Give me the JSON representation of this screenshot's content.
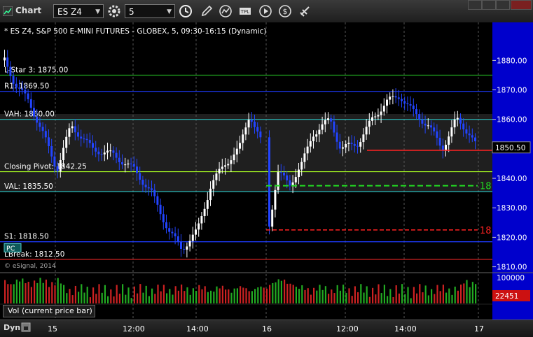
{
  "window": {
    "title": "Chart"
  },
  "toolbar": {
    "symbol": "ES Z4",
    "interval": "5"
  },
  "chart": {
    "header": "* ES Z4, S&P 500 E-MINI FUTURES - GLOBEX, 5, 09:30-16:15 (Dynamic)",
    "copyright": "© eSignal, 2014",
    "price_axis": [
      "1880.00",
      "1870.00",
      "1860.00",
      "1850.00",
      "1840.00",
      "1830.00",
      "1820.00",
      "1810.00"
    ],
    "current_price": "1850.50",
    "ylim": [
      1808,
      1891
    ],
    "levels": [
      {
        "label": "L-Star 3: 1875.00",
        "price": 1875.0,
        "color": "#22aa22"
      },
      {
        "label": "R1: 1869.50",
        "price": 1869.5,
        "color": "#1e3cff"
      },
      {
        "label": "VAH: 1860.00",
        "price": 1860.0,
        "color": "#2bbaba"
      },
      {
        "label": "Closing Pivot: 1842.25",
        "price": 1842.25,
        "color": "#aaff22"
      },
      {
        "label": "VAL: 1835.50",
        "price": 1835.5,
        "color": "#2bbaba"
      },
      {
        "label": "S1: 1818.50",
        "price": 1818.5,
        "color": "#1e3cff"
      },
      {
        "label": "LBreak: 1812.50",
        "price": 1812.5,
        "color": "#cc2222"
      }
    ],
    "trend_labels": {
      "green": "18",
      "red": "18"
    },
    "pc_badge": "PC",
    "time_axis": [
      "15",
      "12:00",
      "14:00",
      "16",
      "12:00",
      "14:00",
      "17"
    ]
  },
  "volume": {
    "label": "Vol (current price bar)",
    "axis_top": "100000",
    "current": "22451"
  },
  "bottom": {
    "dyn_label": "Dyn"
  }
}
